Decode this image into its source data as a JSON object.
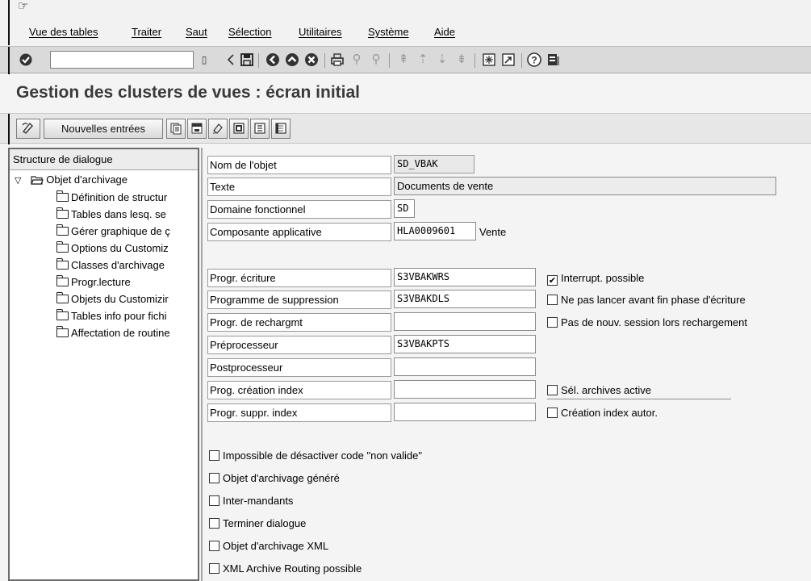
{
  "menu": {
    "glyph": "☞",
    "items": [
      "Vue des tables",
      "Traiter",
      "Saut",
      "Sélection",
      "Utilitaires",
      "Système",
      "Aide"
    ]
  },
  "toolbar": {
    "command_value": "",
    "icons": [
      "enter-icon",
      "dropdown-icon",
      "back-arrow-icon",
      "save-icon",
      "back-icon",
      "exit-icon",
      "cancel-icon",
      "print-icon",
      "find-icon",
      "find-next-icon",
      "first-page-icon",
      "prev-page-icon",
      "next-page-icon",
      "last-page-icon",
      "new-session-icon",
      "shortcut-icon",
      "help-icon",
      "layout-icon"
    ]
  },
  "page_title": "Gestion des clusters de vues : écran initial",
  "app_toolbar": {
    "new_entries_label": "Nouvelles entrées"
  },
  "tree": {
    "header": "Structure de dialogue",
    "root_label": "Objet d'archivage",
    "items": [
      "Définition de structur",
      "Tables dans lesq. se",
      "Gérer graphique de ç",
      "Options du Customiz",
      "Classes d'archivage",
      "Progr.lecture",
      "Objets du Customizir",
      "Tables info pour fichi",
      "Affectation de routine"
    ]
  },
  "fields": {
    "nom_objet": {
      "label": "Nom de l'objet",
      "value": "SD_VBAK"
    },
    "texte": {
      "label": "Texte",
      "value": "Documents de vente"
    },
    "domaine": {
      "label": "Domaine fonctionnel",
      "value": "SD"
    },
    "composante": {
      "label": "Composante applicative",
      "value": "HLA0009601",
      "desc": "Vente"
    },
    "prog_ecriture": {
      "label": "Progr. écriture",
      "value": "S3VBAKWRS"
    },
    "prog_suppression": {
      "label": "Programme de suppression",
      "value": "S3VBAKDLS"
    },
    "prog_rechargement": {
      "label": "Progr. de rechargmt",
      "value": ""
    },
    "preprocesseur": {
      "label": "Préprocesseur",
      "value": "S3VBAKPTS"
    },
    "postprocesseur": {
      "label": "Postprocesseur",
      "value": ""
    },
    "prog_creation_index": {
      "label": "Prog. création index",
      "value": ""
    },
    "prog_suppr_index": {
      "label": "Progr. suppr. index",
      "value": ""
    }
  },
  "side_checks": {
    "interrupt": {
      "label": "Interrupt. possible",
      "checked": true
    },
    "ne_pas_lancer": {
      "label": "Ne pas lancer avant fin phase d'écriture",
      "checked": false
    },
    "pas_nouv_session": {
      "label": "Pas de nouv. session lors rechargement",
      "checked": false
    },
    "sel_archives": {
      "label": "Sél. archives active",
      "checked": false
    },
    "creation_index": {
      "label": "Création index autor.",
      "checked": false
    }
  },
  "bottom_checks": [
    {
      "label": "Impossible de désactiver code \"non valide\"",
      "checked": false
    },
    {
      "label": "Objet d'archivage généré",
      "checked": false
    },
    {
      "label": "Inter-mandants",
      "checked": false
    },
    {
      "label": "Terminer dialogue",
      "checked": false
    },
    {
      "label": "Objet d'archivage XML",
      "checked": false
    },
    {
      "label": "XML Archive Routing possible",
      "checked": false
    }
  ]
}
